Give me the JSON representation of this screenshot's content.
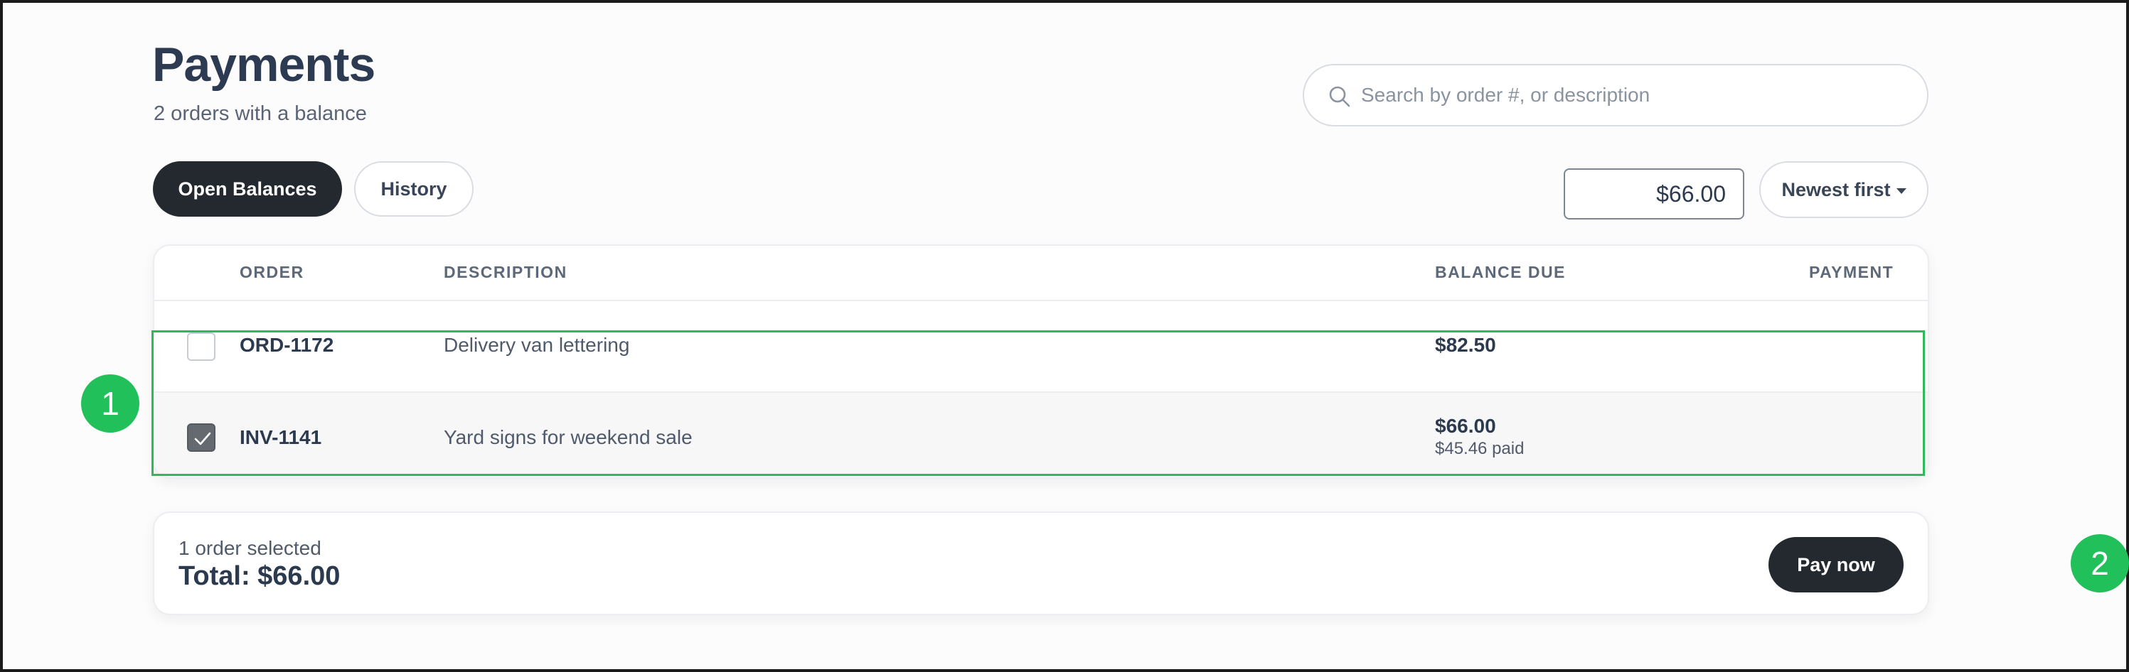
{
  "header": {
    "title": "Payments",
    "subtitle": "2 orders with a balance"
  },
  "search": {
    "placeholder": "Search by order #, or description",
    "value": ""
  },
  "tabs": [
    {
      "label": "Open Balances",
      "active": true
    },
    {
      "label": "History",
      "active": false
    }
  ],
  "sort": {
    "label": "Newest first"
  },
  "table": {
    "columns": [
      "ORDER",
      "DESCRIPTION",
      "BALANCE DUE",
      "PAYMENT"
    ],
    "rows": [
      {
        "order": "ORD-1172",
        "description": "Delivery van lettering",
        "balance": "$82.50",
        "paid": "",
        "payment": "",
        "checked": false
      },
      {
        "order": "INV-1141",
        "description": "Yard signs for weekend sale",
        "balance": "$66.00",
        "paid": "$45.46 paid",
        "payment": "$66.00",
        "checked": true
      }
    ]
  },
  "summary": {
    "selected_text": "1 order selected",
    "total_text": "Total: $66.00",
    "pay_label": "Pay now"
  },
  "annotations": {
    "badge_1": "1",
    "badge_2": "2"
  },
  "colors": {
    "primary_dark": "#24292f",
    "highlight_green": "#22c05a",
    "text": "#2c3a4f"
  },
  "icons": {
    "search": "search-icon",
    "sort": "chevron-down-icon",
    "check": "check-icon"
  }
}
